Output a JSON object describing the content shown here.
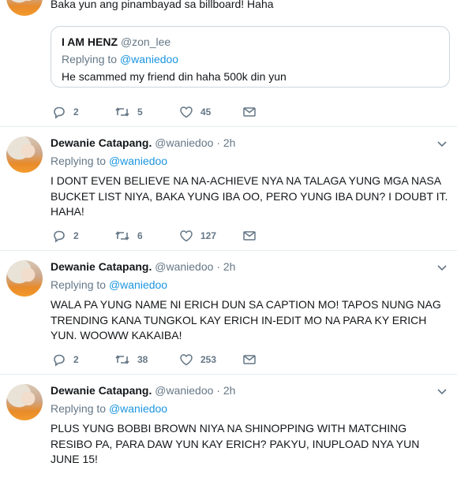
{
  "tweet0": {
    "text_partial": "Baka yun ang pinambayad sa billboard! Haha",
    "quote": {
      "name": "I AM HENZ",
      "handle": "@zon_lee",
      "replying_prefix": "Replying to",
      "replying_to": "@waniedoo",
      "text": "He scammed my friend din haha 500k din yun"
    },
    "replies": "2",
    "retweets": "5",
    "likes": "45"
  },
  "tweets": [
    {
      "name": "Dewanie Catapang.",
      "handle": "@waniedoo",
      "separator": "·",
      "time": "2h",
      "replying_prefix": "Replying to",
      "replying_to": "@waniedoo",
      "text": "I DONT EVEN BELIEVE NA NA-ACHIEVE NYA NA TALAGA YUNG MGA NASA BUCKET LIST NIYA, BAKA YUNG IBA OO, PERO YUNG IBA DUN? I DOUBT IT. HAHA!",
      "replies": "2",
      "retweets": "6",
      "likes": "127"
    },
    {
      "name": "Dewanie Catapang.",
      "handle": "@waniedoo",
      "separator": "·",
      "time": "2h",
      "replying_prefix": "Replying to",
      "replying_to": "@waniedoo",
      "text": "WALA PA YUNG NAME NI ERICH DUN SA CAPTION MO! TAPOS NUNG NAG TRENDING KANA TUNGKOL KAY ERICH IN-EDIT MO NA PARA KY ERICH YUN. WOOWW KAKAIBA!",
      "replies": "2",
      "retweets": "38",
      "likes": "253"
    },
    {
      "name": "Dewanie Catapang.",
      "handle": "@waniedoo",
      "separator": "·",
      "time": "2h",
      "replying_prefix": "Replying to",
      "replying_to": "@waniedoo",
      "text": "PLUS YUNG BOBBI BROWN NIYA NA SHINOPPING WITH MATCHING RESIBO PA, PARA DAW YUN KAY ERICH? PAKYU, INUPLOAD NYA YUN JUNE 15!"
    }
  ]
}
